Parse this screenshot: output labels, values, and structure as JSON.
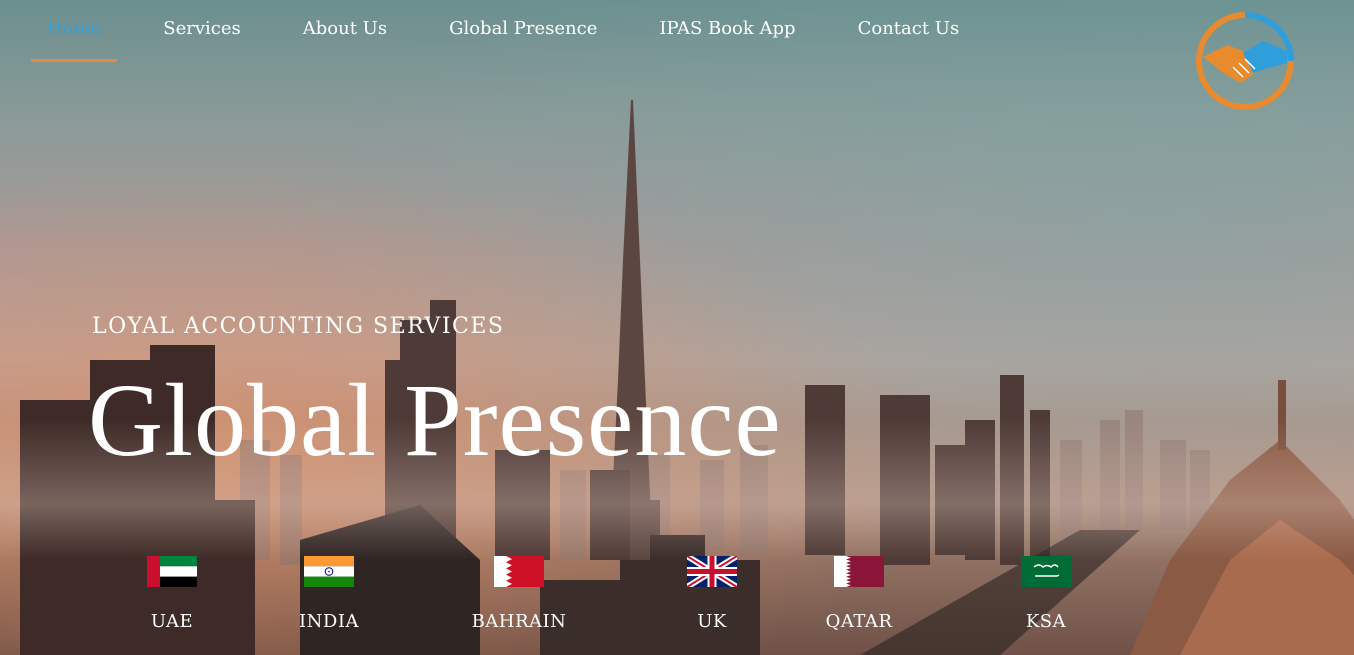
{
  "nav": {
    "items": [
      {
        "label": "Home",
        "active": true
      },
      {
        "label": "Services",
        "active": false
      },
      {
        "label": "About Us",
        "active": false
      },
      {
        "label": "Global Presence",
        "active": false
      },
      {
        "label": "IPAS Book App",
        "active": false
      },
      {
        "label": "Contact Us",
        "active": false
      }
    ]
  },
  "logo": {
    "icon": "handshake-logo",
    "colors": [
      "#e88a2e",
      "#2f9fdc"
    ]
  },
  "hero": {
    "subtitle": "LOYAL ACCOUNTING SERVICES",
    "title": "Global Presence"
  },
  "countries": [
    {
      "label": "UAE",
      "flag": "uae-flag-icon"
    },
    {
      "label": "INDIA",
      "flag": "india-flag-icon"
    },
    {
      "label": "BAHRAIN",
      "flag": "bahrain-flag-icon"
    },
    {
      "label": "UK",
      "flag": "uk-flag-icon"
    },
    {
      "label": "QATAR",
      "flag": "qatar-flag-icon"
    },
    {
      "label": "KSA",
      "flag": "ksa-flag-icon"
    }
  ],
  "colors": {
    "accent_active": "#2fa0e0",
    "accent_underline": "#e88a3a"
  }
}
